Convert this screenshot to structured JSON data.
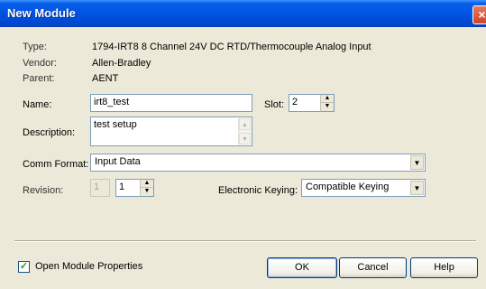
{
  "window": {
    "title": "New Module",
    "close_glyph": "×"
  },
  "module": {
    "type_label": "Type:",
    "type_value": "1794-IRT8 8 Channel 24V DC RTD/Thermocouple Analog Input",
    "vendor_label": "Vendor:",
    "vendor_value": "Allen-Bradley",
    "parent_label": "Parent:",
    "parent_value": "AENT"
  },
  "form": {
    "name_label": "Name:",
    "name_value": "irt8_test",
    "slot_label": "Slot:",
    "slot_value": "2",
    "description_label": "Description:",
    "description_value": "test setup",
    "comm_format_label": "Comm Format:",
    "comm_format_value": "Input Data",
    "revision_label": "Revision:",
    "revision_major": "1",
    "revision_minor": "1",
    "keying_label": "Electronic Keying:",
    "keying_value": "Compatible Keying"
  },
  "footer": {
    "open_props_label": "Open Module Properties",
    "open_props_checked": true,
    "ok_label": "OK",
    "cancel_label": "Cancel",
    "help_label": "Help"
  },
  "icons": {
    "check": "✓",
    "spin_up": "▲",
    "spin_down": "▼",
    "dropdown": "▼"
  }
}
